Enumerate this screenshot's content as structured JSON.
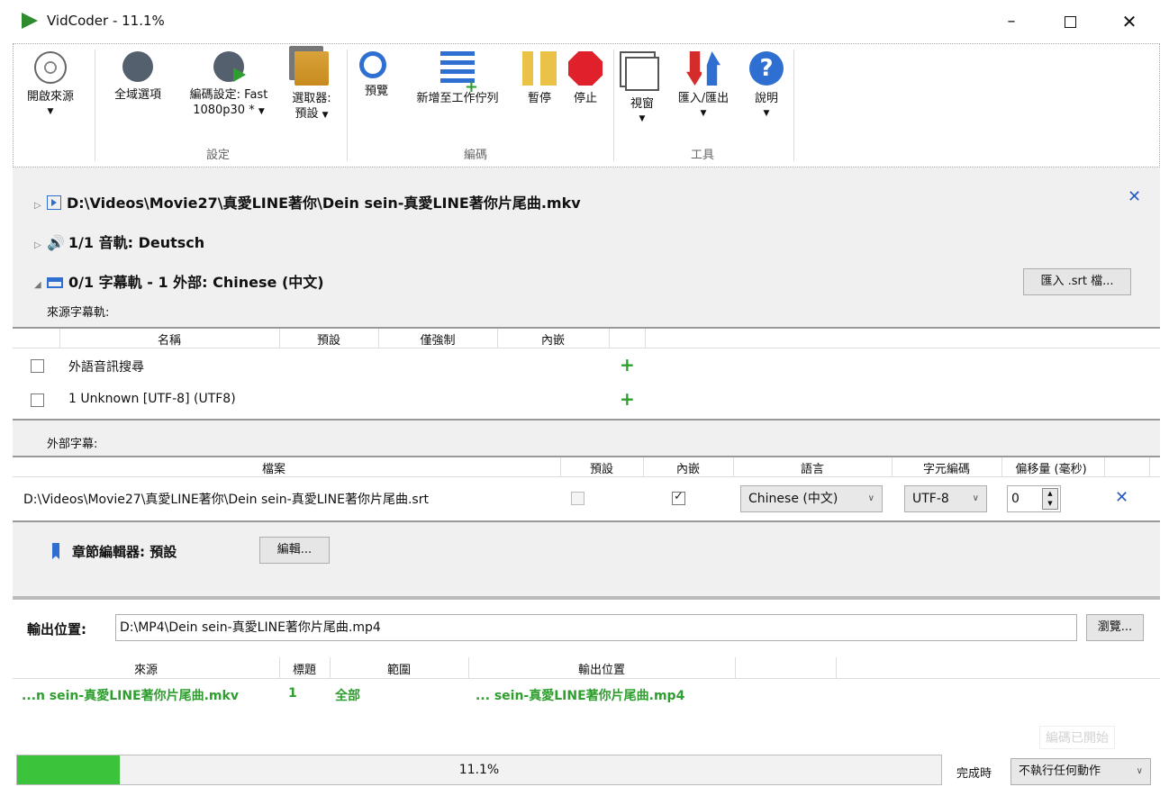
{
  "titlebar": {
    "title": "VidCoder - 11.1%",
    "minimize": "–",
    "close": "✕"
  },
  "ribbon": {
    "open_source": "開啟來源",
    "global_options": "全域選項",
    "encode_settings_line1": "編碼設定: Fast",
    "encode_settings_line2": "1080p30 *",
    "picker_line1": "選取器:",
    "picker_line2": "預設",
    "group_settings": "設定",
    "preview": "預覽",
    "add_to_queue": "新增至工作佇列",
    "pause": "暫停",
    "stop": "停止",
    "group_encoding": "編碼",
    "window": "視窗",
    "import_export": "匯入/匯出",
    "help": "說明",
    "group_tools": "工具"
  },
  "source": {
    "path": "D:\\Videos\\Movie27\\真愛LINE著你\\Dein sein-真愛LINE著你片尾曲.mkv",
    "audio": "1/1 音軌: Deutsch",
    "subtitles": "0/1 字幕軌 - 1 外部: Chinese (中文)",
    "import_srt": "匯入 .srt 檔..."
  },
  "source_subs": {
    "label": "來源字幕軌:",
    "headers": [
      "名稱",
      "預設",
      "僅強制",
      "內嵌"
    ],
    "rows": [
      {
        "name": "外語音訊搜尋"
      },
      {
        "name": "1 Unknown [UTF-8] (UTF8)"
      }
    ]
  },
  "external_subs": {
    "label": "外部字幕:",
    "headers": [
      "檔案",
      "預設",
      "內嵌",
      "語言",
      "字元編碼",
      "偏移量 (毫秒)"
    ],
    "row": {
      "file": "D:\\Videos\\Movie27\\真愛LINE著你\\Dein sein-真愛LINE著你片尾曲.srt",
      "default_checked": false,
      "burn_checked": true,
      "language": "Chinese (中文)",
      "encoding": "UTF-8",
      "offset": "0"
    }
  },
  "chapters": {
    "label": "章節編輯器: 預設",
    "edit": "編輯..."
  },
  "output": {
    "label": "輸出位置:",
    "path": "D:\\MP4\\Dein sein-真愛LINE著你片尾曲.mp4",
    "browse": "瀏覽..."
  },
  "queue": {
    "headers": [
      "來源",
      "標題",
      "範圍",
      "輸出位置"
    ],
    "row": {
      "source": "...n sein-真愛LINE著你片尾曲.mkv",
      "title": "1",
      "range": "全部",
      "output": "... sein-真愛LINE著你片尾曲.mp4"
    },
    "encode_started": "編碼已開始"
  },
  "progress": {
    "percent": 11.1,
    "text": "11.1%"
  },
  "completion": {
    "label": "完成時",
    "action": "不執行任何動作"
  },
  "colors": {
    "accent_blue": "#2f6fd1",
    "progress_green": "#3cc33c",
    "queue_green": "#2e9e2e"
  }
}
